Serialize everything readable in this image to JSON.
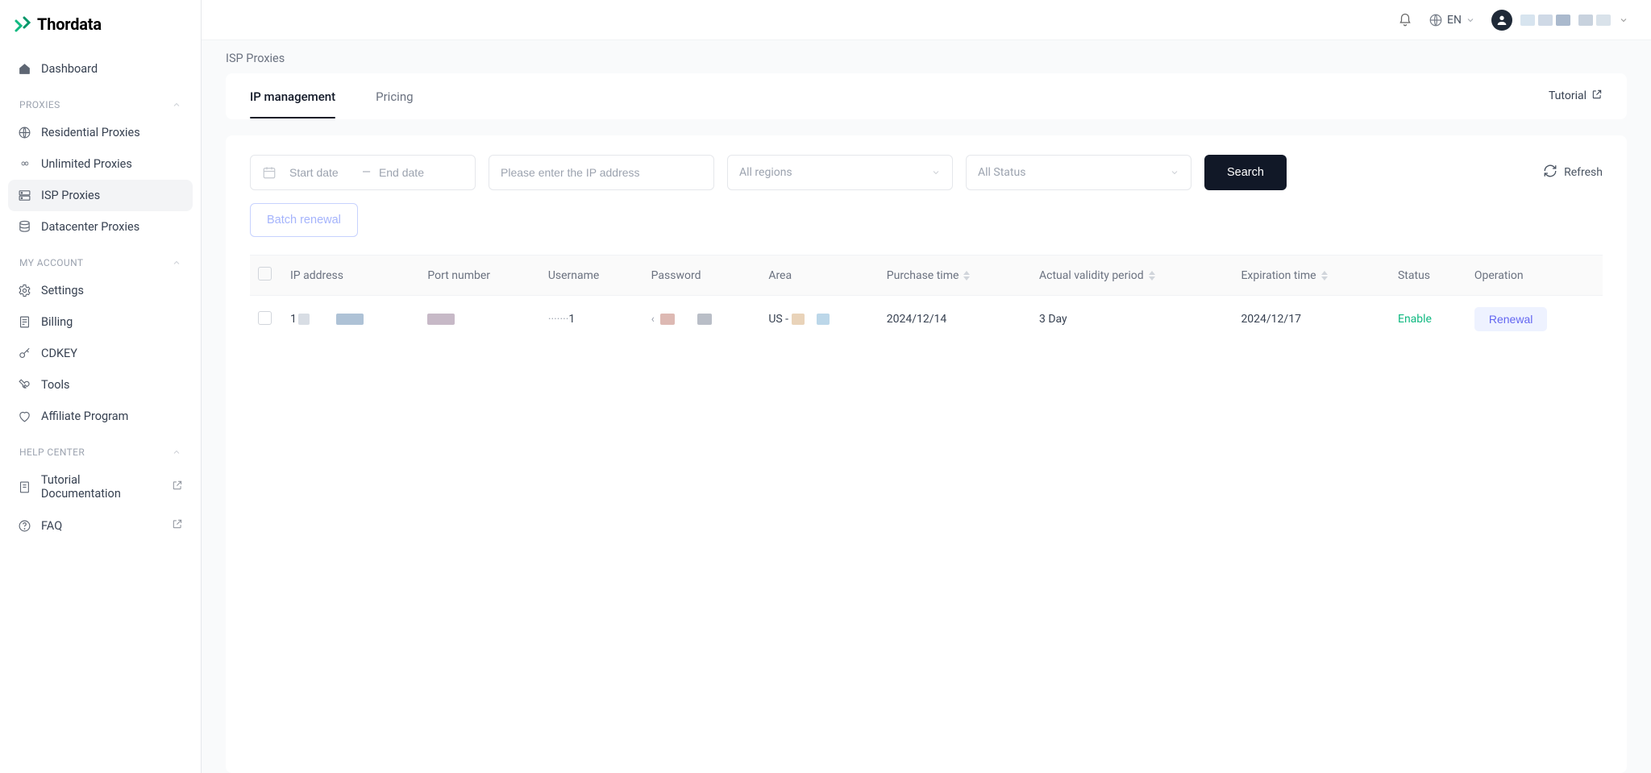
{
  "brand": "Thordata",
  "topbar": {
    "lang": "EN"
  },
  "breadcrumb": "ISP Proxies",
  "sidebar": {
    "dashboard": "Dashboard",
    "sections": {
      "proxies": "PROXIES",
      "account": "MY ACCOUNT",
      "help": "HELP CENTER"
    },
    "items": {
      "residential": "Residential Proxies",
      "unlimited": "Unlimited Proxies",
      "isp": "ISP Proxies",
      "datacenter": "Datacenter Proxies",
      "settings": "Settings",
      "billing": "Billing",
      "cdkey": "CDKEY",
      "tools": "Tools",
      "affiliate": "Affiliate Program",
      "tutorial_doc": "Tutorial Documentation",
      "faq": "FAQ"
    }
  },
  "tabs": {
    "ip_management": "IP management",
    "pricing": "Pricing",
    "tutorial": "Tutorial"
  },
  "filters": {
    "start_placeholder": "Start date",
    "end_placeholder": "End date",
    "ip_placeholder": "Please enter the IP address",
    "region_placeholder": "All regions",
    "status_placeholder": "All Status",
    "search": "Search",
    "refresh": "Refresh",
    "batch_renewal": "Batch renewal"
  },
  "table": {
    "headers": {
      "ip": "IP address",
      "port": "Port number",
      "username": "Username",
      "password": "Password",
      "area": "Area",
      "purchase": "Purchase time",
      "validity": "Actual validity period",
      "expiration": "Expiration time",
      "status": "Status",
      "operation": "Operation"
    },
    "rows": [
      {
        "ip_prefix": "1",
        "username_suffix": "1",
        "area_prefix": "US - ",
        "purchase": "2024/12/14",
        "validity": "3 Day",
        "expiration": "2024/12/17",
        "status": "Enable",
        "operation": "Renewal"
      }
    ]
  }
}
